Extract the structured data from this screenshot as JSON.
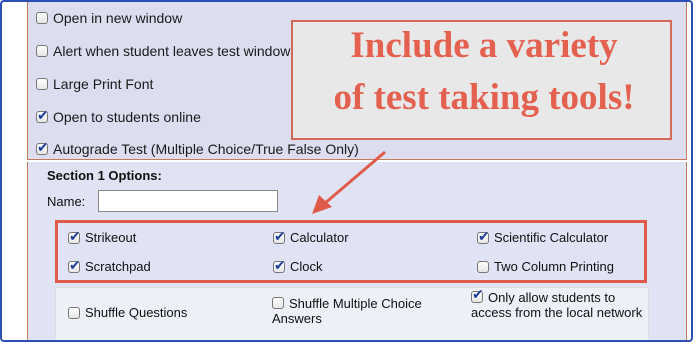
{
  "top_options": [
    {
      "label": "Open in new window",
      "checked": false
    },
    {
      "label": "Alert when student leaves test window",
      "checked": false
    },
    {
      "label": "Large Print Font",
      "checked": false
    },
    {
      "label": "Open to students online",
      "checked": true
    },
    {
      "label": "Autograde Test (Multiple Choice/True False Only)",
      "checked": true
    }
  ],
  "section": {
    "title": "Section 1 Options:",
    "name_label": "Name:",
    "name_value": ""
  },
  "tools": [
    {
      "label": "Strikeout",
      "checked": true
    },
    {
      "label": "Calculator",
      "checked": true
    },
    {
      "label": "Scientific Calculator",
      "checked": true
    },
    {
      "label": "Scratchpad",
      "checked": true
    },
    {
      "label": "Clock",
      "checked": true
    },
    {
      "label": "Two Column Printing",
      "checked": false
    }
  ],
  "bottom_options": [
    {
      "label": "Shuffle Questions",
      "checked": false
    },
    {
      "label": "Shuffle Multiple Choice Answers",
      "checked": false
    },
    {
      "label": "Only allow students to access from the local network",
      "checked": true
    }
  ],
  "callout": {
    "text": "Include a variety\nof test taking tools!"
  },
  "colors": {
    "accent": "#e05a4a",
    "panel": "#dcdef0",
    "frame": "#2a4fb5"
  }
}
